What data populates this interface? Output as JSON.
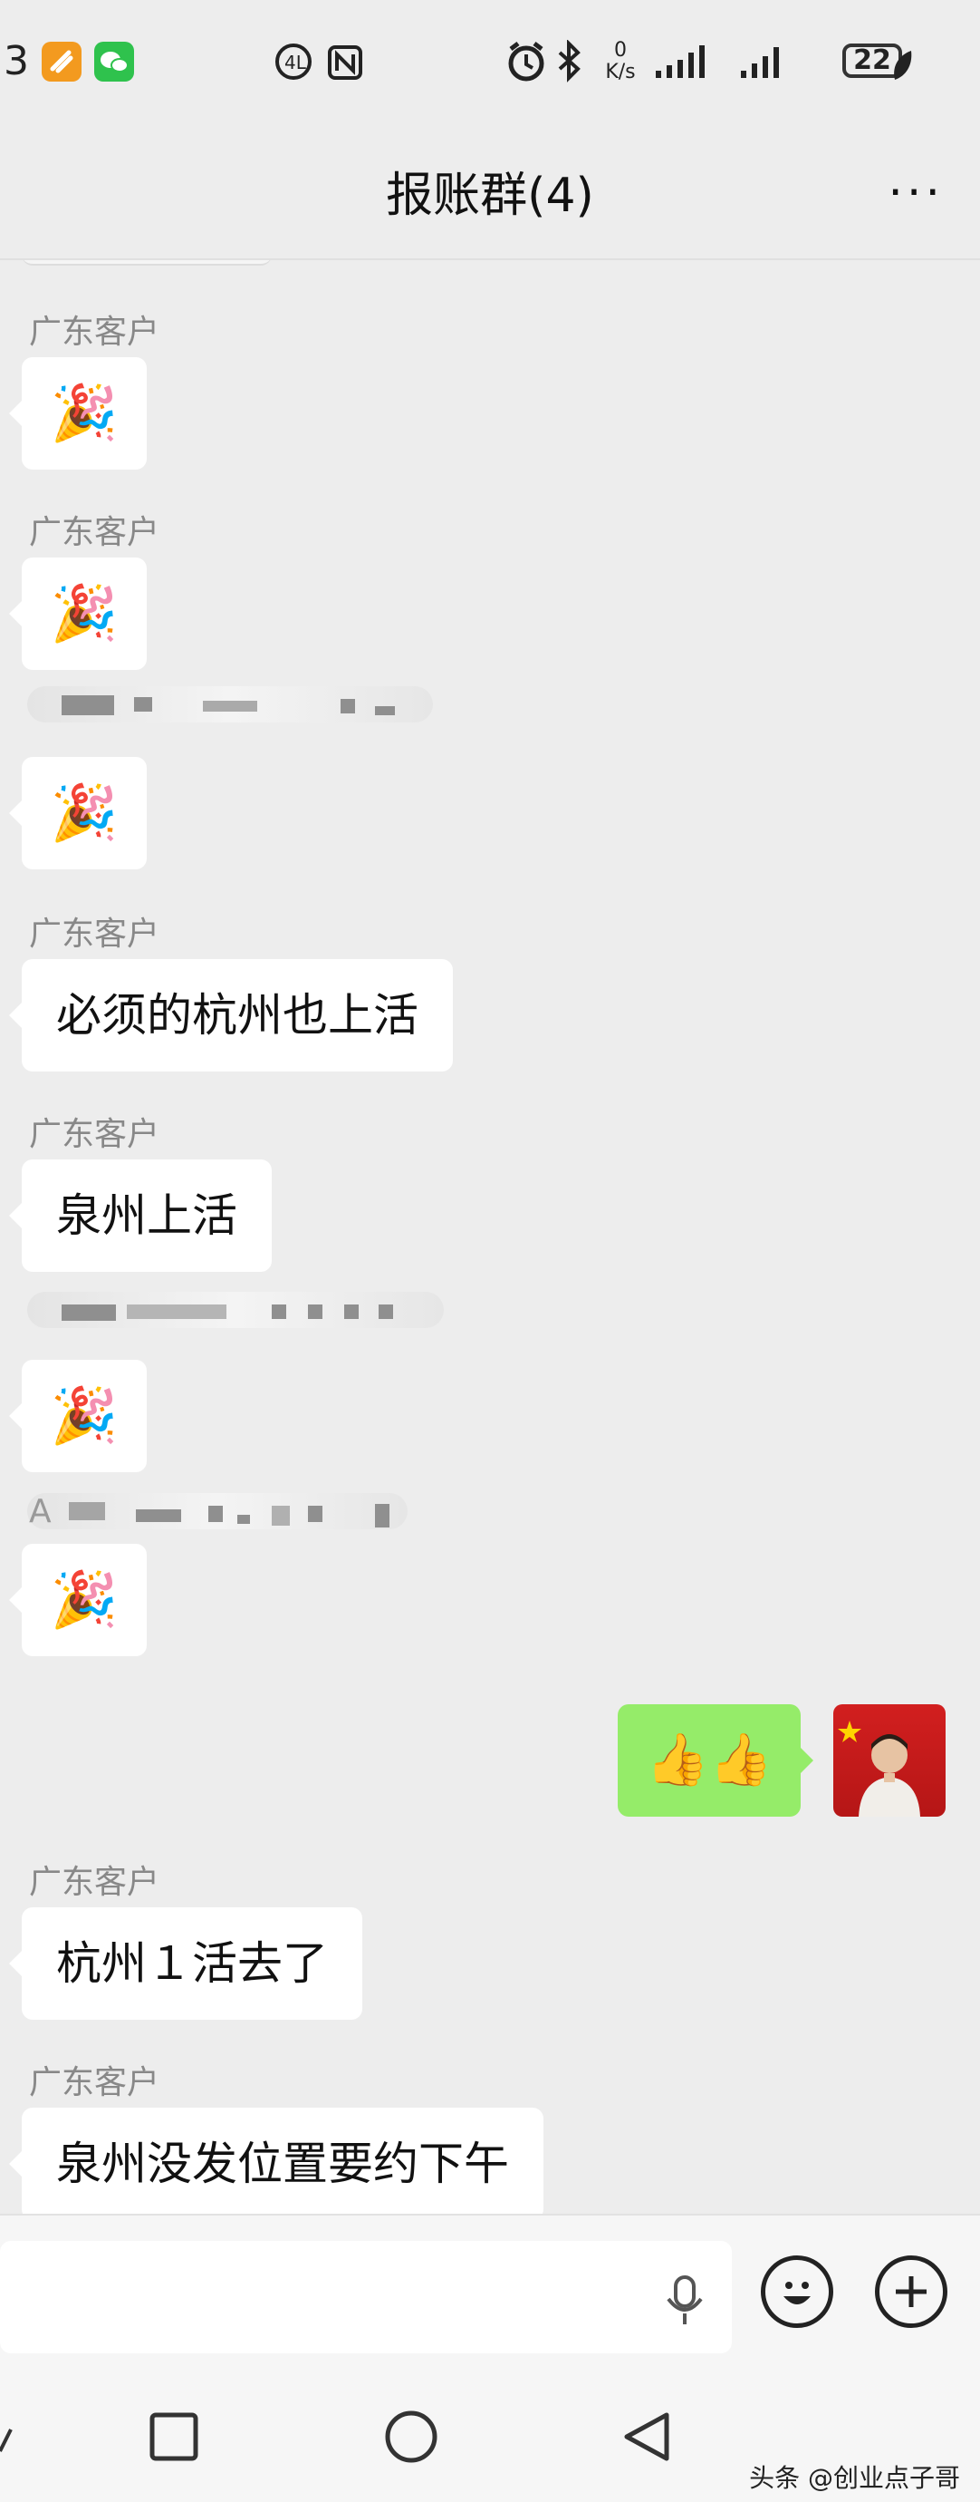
{
  "status_bar": {
    "time_partial": "3",
    "net_speed_value": "0",
    "net_speed_unit": "K/s",
    "battery": "22"
  },
  "header": {
    "title": "报账群(4)",
    "more_label": "···"
  },
  "messages": [
    {
      "sender": "广东客户",
      "type": "emoji",
      "content": "🎉"
    },
    {
      "sender": "广东客户",
      "type": "emoji",
      "content": "🎉"
    },
    {
      "sender": "",
      "type": "emoji",
      "content": "🎉"
    },
    {
      "sender": "广东客户",
      "type": "text",
      "content": "必须的杭州也上活"
    },
    {
      "sender": "广东客户",
      "type": "text",
      "content": "泉州上活"
    },
    {
      "sender": "",
      "type": "emoji",
      "content": "🎉"
    },
    {
      "sender": "A",
      "type": "emoji",
      "content": "🎉"
    },
    {
      "sender": "",
      "type": "outgoing",
      "content": "👍👍"
    },
    {
      "sender": "广东客户",
      "type": "text",
      "content": "杭州１活去了"
    },
    {
      "sender": "广东客户",
      "type": "text",
      "content": "泉州没发位置要约下午"
    }
  ],
  "watermark": "头条 @创业点子哥",
  "colors": {
    "background": "#ededed",
    "outgoing_bubble": "#95ec69",
    "incoming_bubble": "#ffffff"
  }
}
